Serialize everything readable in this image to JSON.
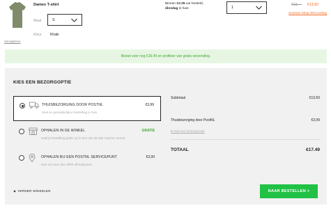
{
  "product": {
    "name": "Dames T-shirt",
    "size_label": "Maat",
    "size_value": "S",
    "color_label": "Kleur",
    "color_value": "Khaki",
    "remove_label": "Verwijderen",
    "image_color": "#7f8b6a",
    "delivery_line1_pre": "Binnen ",
    "delivery_time": "12:25",
    "delivery_line1_post": " uur besteld,",
    "delivery_day": "dinsdag",
    "delivery_line2_post": " in huis",
    "quantity": "1",
    "old_price": "€18,—",
    "new_price": "€13,50",
    "promo": "Summer Shop 25% korting"
  },
  "banner": {
    "text": "Bestel voor nog €16,49 en profiteer van gratis verzending.",
    "bg_color": "#e6f6e3",
    "text_color": "#3fa630"
  },
  "checkout": {
    "title": "KIES EEN BEZORGOPTIE",
    "options": [
      {
        "title": "THUISBEZORGING DOOR POSTNL",
        "desc": "Snel en gemakkelijk je bestelling in huis",
        "price": "€3,99",
        "icon": "truck-icon",
        "selected": true
      },
      {
        "title": "OPHALEN IN DE WINKEL",
        "desc": "Haal je bestelling gratis op in een van de WE Fashion stores",
        "price": "GRATIS",
        "icon": "store-icon",
        "selected": false
      },
      {
        "title": "OPHALEN BIJ EEN POSTNL SERVICEPUNT",
        "desc": "Kies uit meer dan 2500 afhaalpunten",
        "price": "€3,99",
        "icon": "location-pin-icon",
        "selected": false
      }
    ],
    "subtotal_label": "Subtotaal",
    "subtotal_value": "€13,50",
    "shipping_label": "Thuisbezorging door PostNL",
    "shipping_value": "€3,99",
    "coupon_link": "Ik heb een kortingscode",
    "total_label": "TOTAAL",
    "total_value": "€17.49",
    "continue_label": "VERDER WINKELEN",
    "checkout_button": "NAAR BESTELLEN >",
    "accent_green": "#21c145",
    "accent_orange": "#f26722"
  }
}
